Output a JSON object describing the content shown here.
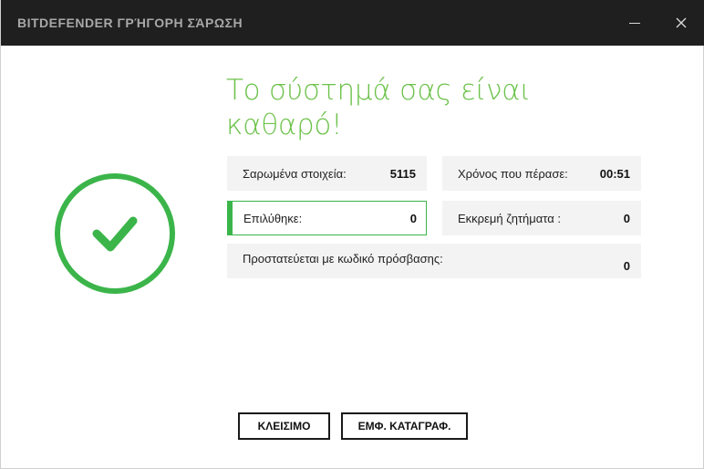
{
  "window": {
    "title": "BITDEFENDER ΓΡΉΓΟΡΗ ΣΆΡΩΣΗ",
    "minimize_icon": "minimize-icon",
    "close_icon": "close-icon"
  },
  "status": {
    "icon": "check-circle-icon",
    "headline": "Το σύστημά σας είναι καθαρό!",
    "color": "#6cc24a",
    "ring_color": "#3bb54a"
  },
  "stats": {
    "scanned": {
      "label": "Σαρωμένα στοιχεία:",
      "value": "5115"
    },
    "elapsed": {
      "label": "Χρόνος που πέρασε:",
      "value": "00:51"
    },
    "resolved": {
      "label": "Επιλύθηκε:",
      "value": "0"
    },
    "pending": {
      "label": "Εκκρεμή ζητήματα :",
      "value": "0"
    },
    "protected": {
      "label": "Προστατεύεται με κωδικό πρόσβασης:",
      "value": "0"
    }
  },
  "buttons": {
    "close_label": "ΚΛΕΙΣΙΜΟ",
    "log_label": "ΕΜΦ. ΚΑΤΑΓΡΑΦ."
  }
}
